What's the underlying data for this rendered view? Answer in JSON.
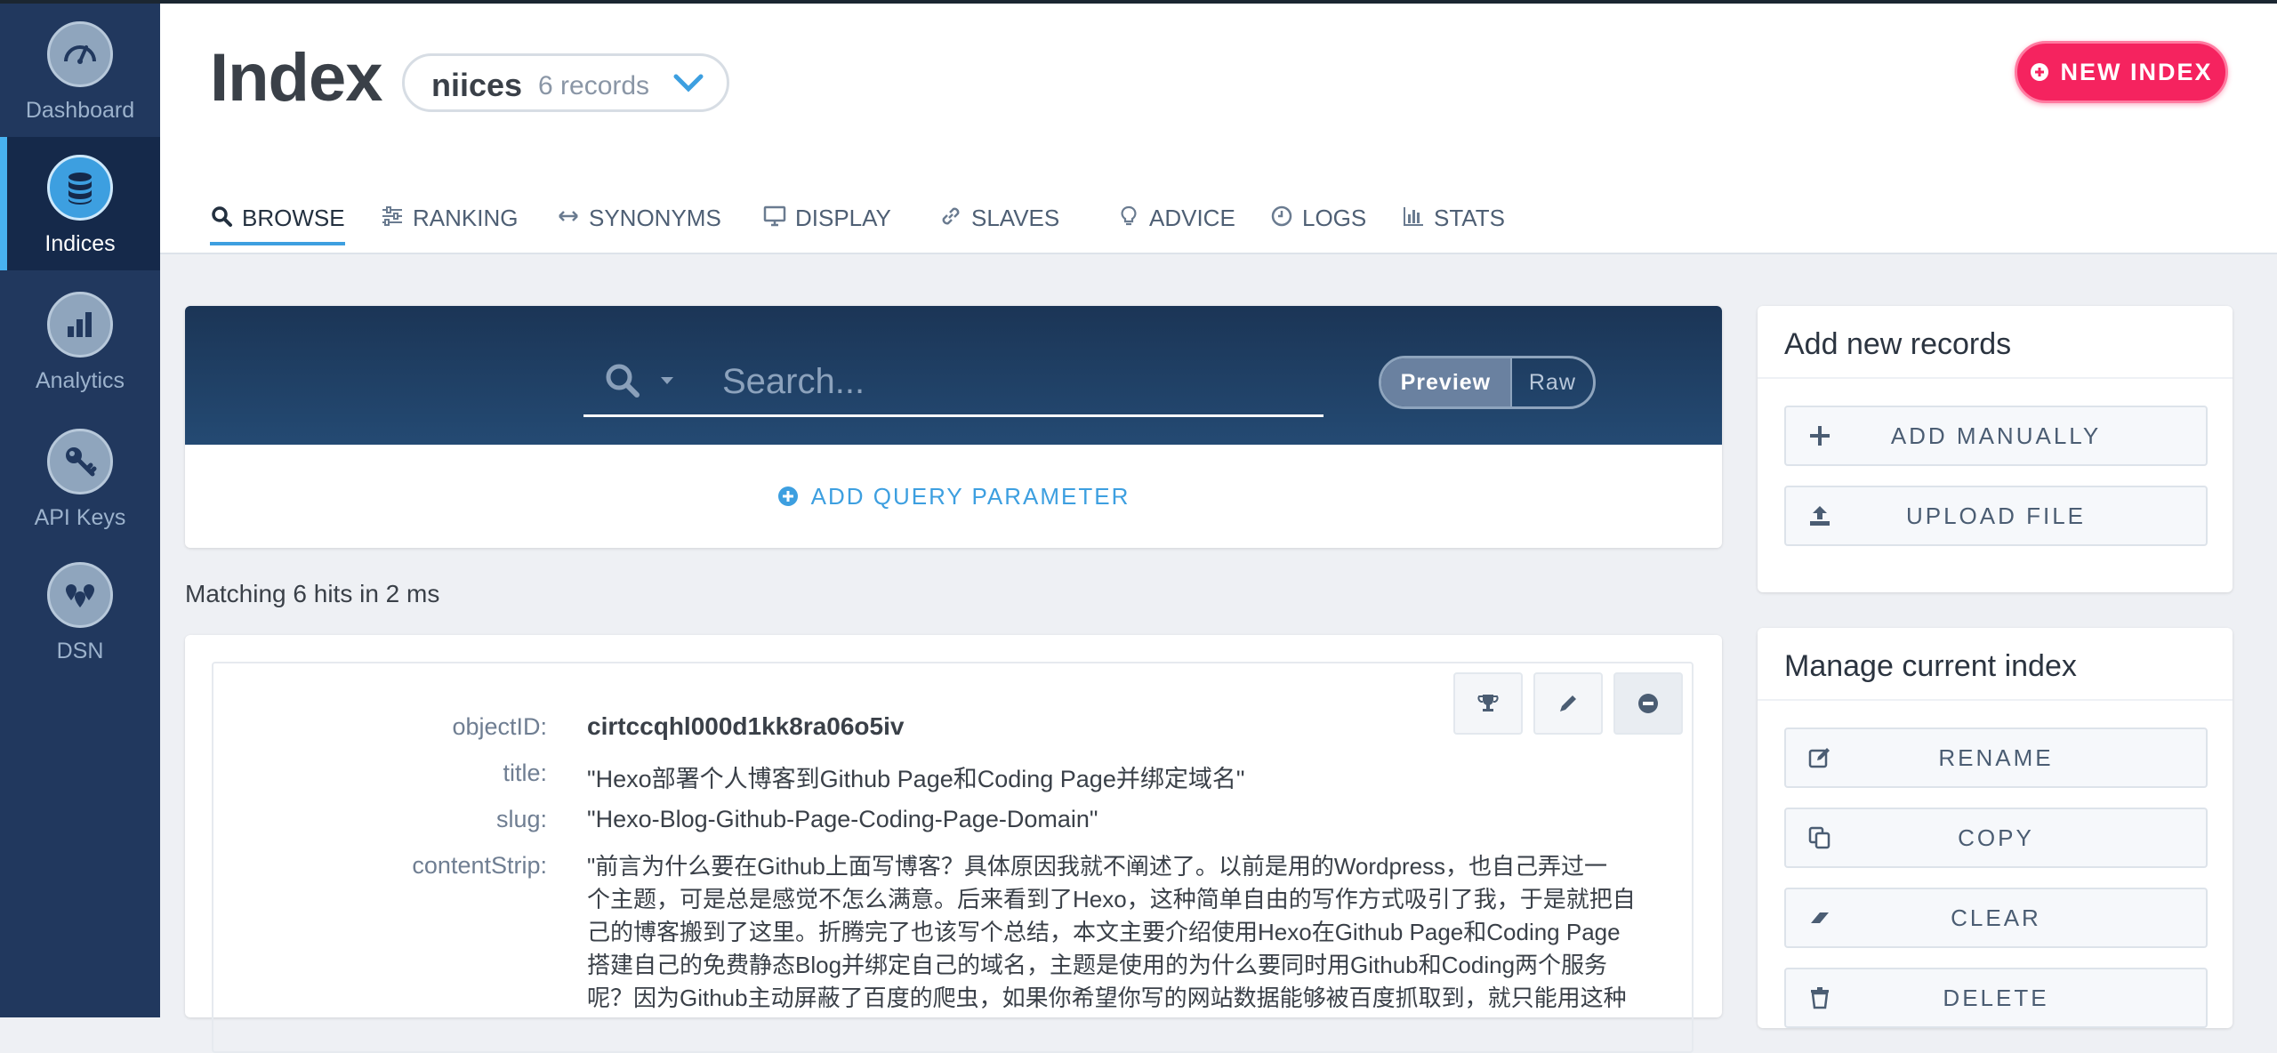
{
  "sidebar": {
    "items": [
      {
        "label": "Dashboard",
        "icon": "gauge-icon"
      },
      {
        "label": "Indices",
        "icon": "database-icon"
      },
      {
        "label": "Analytics",
        "icon": "bar-chart-icon"
      },
      {
        "label": "API Keys",
        "icon": "key-icon"
      },
      {
        "label": "DSN",
        "icon": "map-pins-icon"
      }
    ],
    "active": "Indices"
  },
  "header": {
    "title": "Index",
    "index_name": "niices",
    "index_count": "6 records",
    "new_index_label": "NEW INDEX",
    "tabs": [
      {
        "label": "BROWSE",
        "icon": "search-icon"
      },
      {
        "label": "RANKING",
        "icon": "sliders-icon"
      },
      {
        "label": "SYNONYMS",
        "icon": "arrows-horizontal-icon"
      },
      {
        "label": "DISPLAY",
        "icon": "monitor-icon"
      },
      {
        "label": "SLAVES",
        "icon": "link-icon"
      },
      {
        "label": "ADVICE",
        "icon": "lightbulb-icon"
      },
      {
        "label": "LOGS",
        "icon": "clock-icon"
      },
      {
        "label": "STATS",
        "icon": "stats-icon"
      }
    ],
    "active_tab": "BROWSE"
  },
  "search": {
    "placeholder": "Search...",
    "preview_label": "Preview",
    "raw_label": "Raw",
    "add_param_label": "ADD QUERY PARAMETER"
  },
  "results": {
    "summary": "Matching 6 hits in 2 ms"
  },
  "record": {
    "objectID_label": "objectID:",
    "objectID": "cirtccqhl000d1kk8ra06o5iv",
    "title_label": "title:",
    "title": "\"Hexo部署个人博客到Github Page和Coding Page并绑定域名\"",
    "slug_label": "slug:",
    "slug": "\"Hexo-Blog-Github-Page-Coding-Page-Domain\"",
    "content_label": "contentStrip:",
    "content_lines": [
      "\"前言为什么要在Github上面写博客？具体原因我就不阐述了。以前是用的Wordpress，也自己弄过一",
      "个主题，可是总是感觉不怎么满意。后来看到了Hexo，这种简单自由的写作方式吸引了我，于是就把自",
      "己的博客搬到了这里。折腾完了也该写个总结，本文主要介绍使用Hexo在Github Page和Coding Page",
      "搭建自己的免费静态Blog并绑定自己的域名，主题是使用的为什么要同时用Github和Coding两个服务",
      "呢？因为Github主动屏蔽了百度的爬虫，如果你希望你写的网站数据能够被百度抓取到，就只能用这种"
    ]
  },
  "panels": {
    "add": {
      "title": "Add new records",
      "buttons": [
        "ADD MANUALLY",
        "UPLOAD FILE"
      ]
    },
    "manage": {
      "title": "Manage current index",
      "buttons": [
        "RENAME",
        "COPY",
        "CLEAR",
        "DELETE"
      ]
    }
  },
  "colors": {
    "sidebar": "#21385e",
    "accent": "#3d9fe0",
    "brand_pink": "#f5235f"
  }
}
